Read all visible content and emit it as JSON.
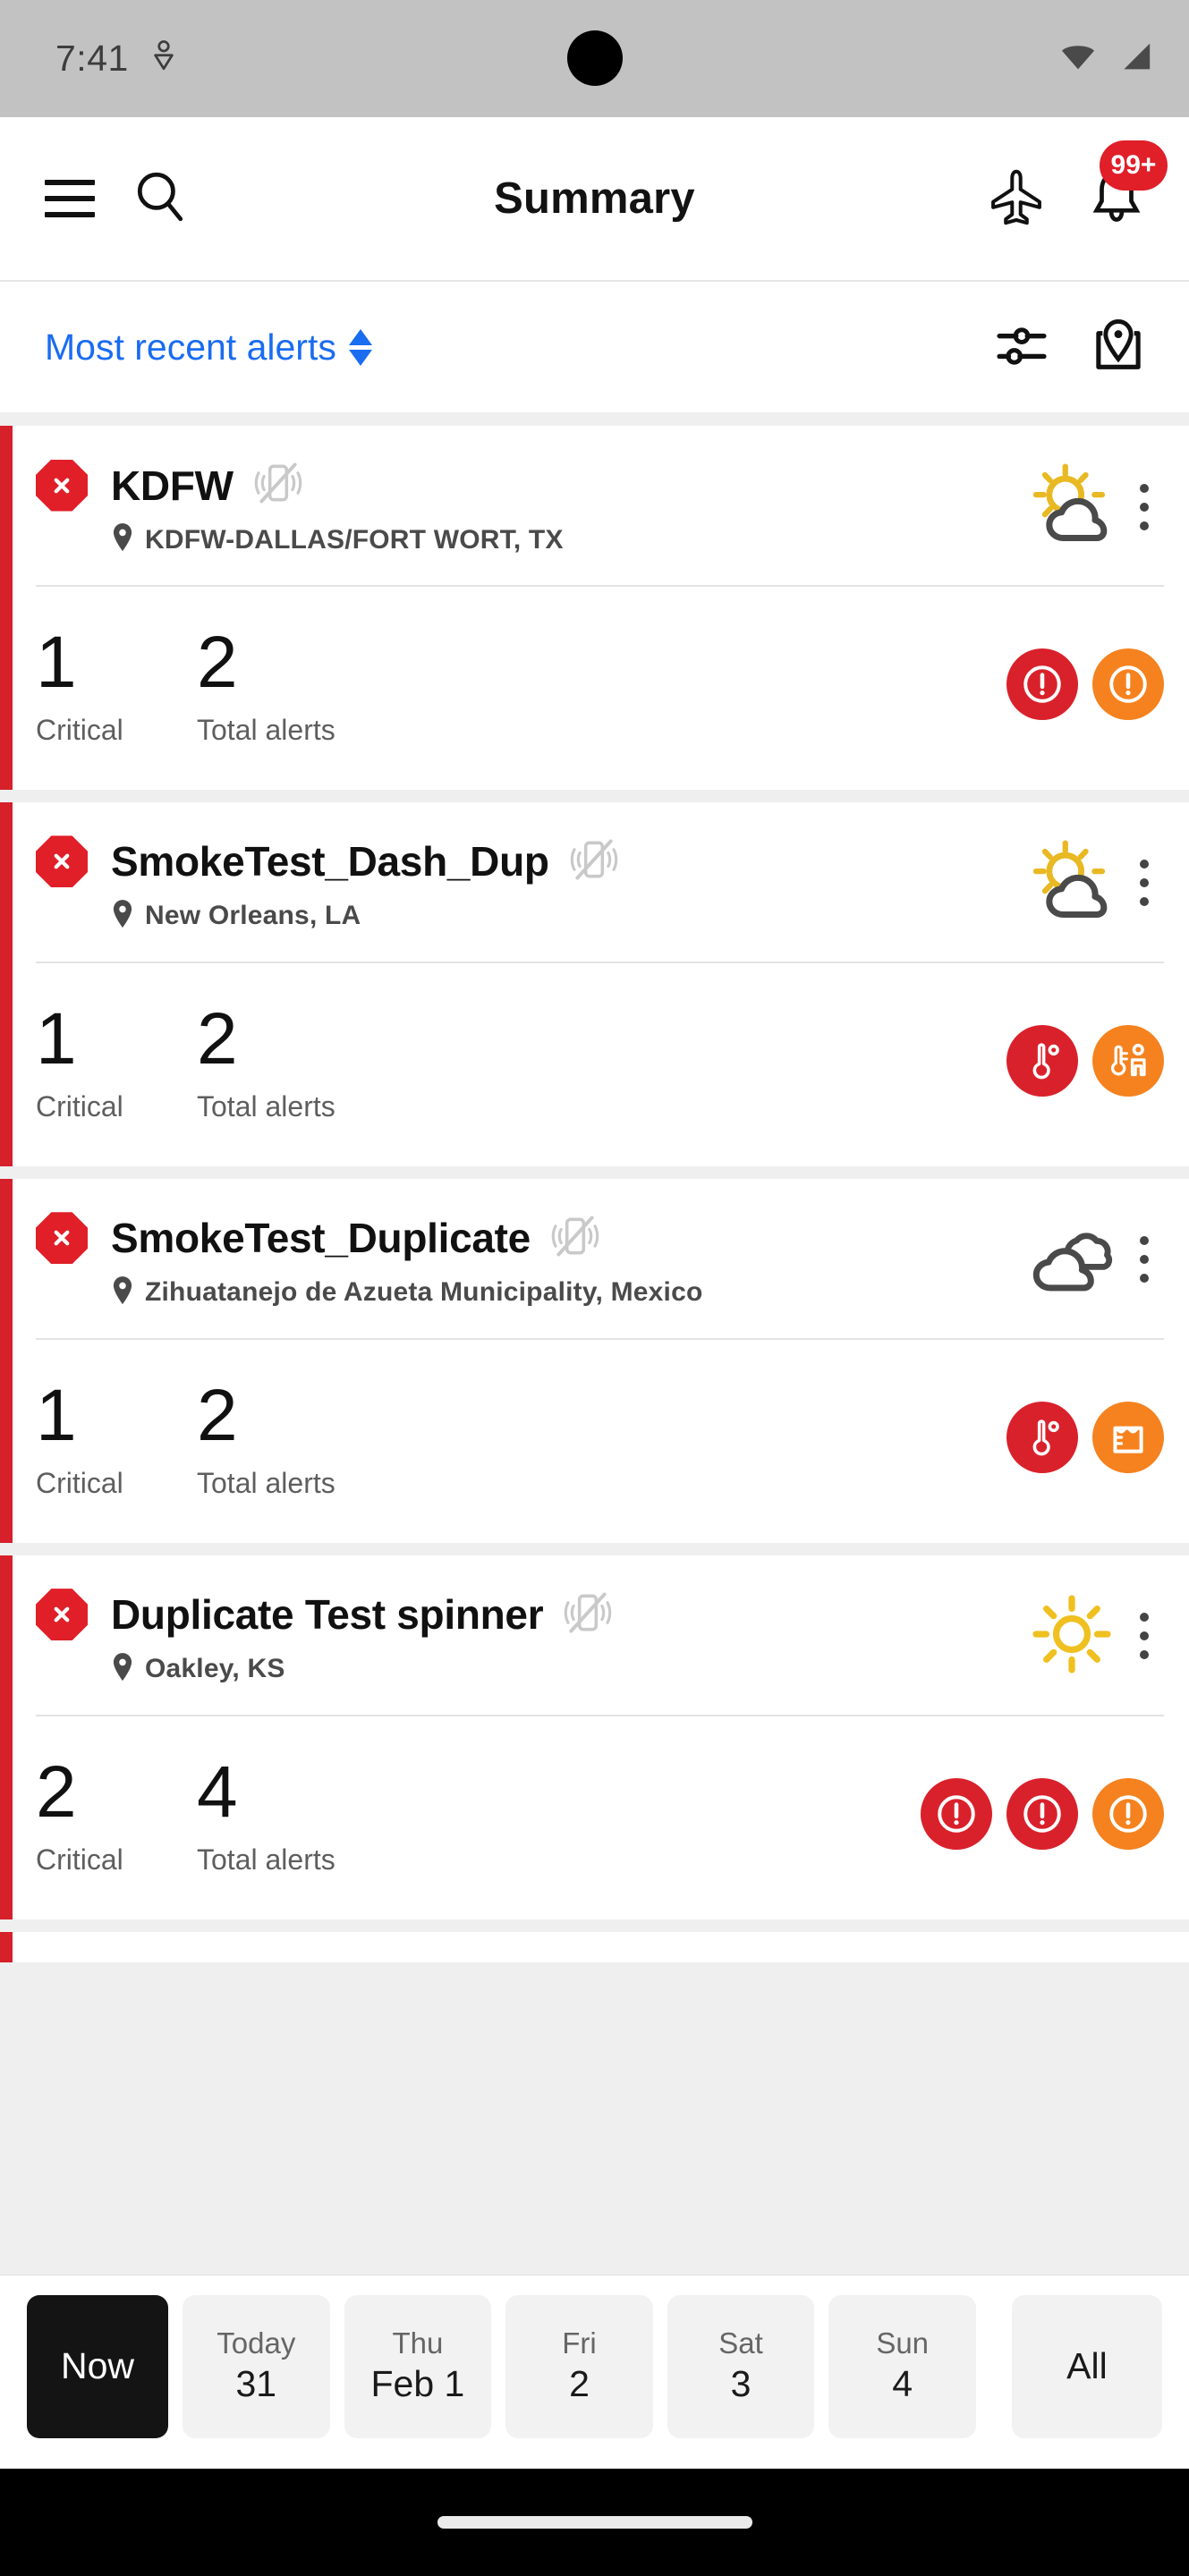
{
  "status_bar": {
    "time": "7:41",
    "left_icon": "location-sharing-icon",
    "wifi_icon": "wifi-icon",
    "signal_icon": "cellular-signal-icon"
  },
  "app_bar": {
    "menu_icon": "hamburger-menu-icon",
    "search_icon": "search-icon",
    "title": "Summary",
    "flight_icon": "airplane-icon",
    "notifications_icon": "bell-icon",
    "notification_badge": "99+",
    "badge_color": "#e01f28"
  },
  "filter_bar": {
    "sort_label": "Most recent alerts",
    "sort_icon": "sort-arrows-icon",
    "sort_color": "#1a6cf0",
    "filter_icon": "filter-sliders-icon",
    "map_icon": "map-pin-icon"
  },
  "cards": [
    {
      "status_icon": "stop-octagon-x-icon",
      "name": "KDFW",
      "mute_icon": "vibrate-off-icon",
      "location": "KDFW-DALLAS/FORT WORT, TX",
      "location_icon": "map-pin-icon",
      "weather_icon": "partly-cloudy-icon",
      "menu_icon": "kebab-menu-icon",
      "critical_value": "1",
      "critical_label": "Critical",
      "total_value": "2",
      "total_label": "Total alerts",
      "badges": [
        {
          "icon": "alert-exclamation-icon",
          "color": "red"
        },
        {
          "icon": "alert-exclamation-icon",
          "color": "orange"
        }
      ]
    },
    {
      "status_icon": "stop-octagon-x-icon",
      "name": "SmokeTest_Dash_Dup",
      "mute_icon": "vibrate-off-icon",
      "location": "New Orleans, LA",
      "location_icon": "map-pin-icon",
      "weather_icon": "partly-cloudy-icon",
      "menu_icon": "kebab-menu-icon",
      "critical_value": "1",
      "critical_label": "Critical",
      "total_value": "2",
      "total_label": "Total alerts",
      "badges": [
        {
          "icon": "temperature-icon",
          "color": "red"
        },
        {
          "icon": "feels-like-temperature-icon",
          "color": "orange"
        }
      ]
    },
    {
      "status_icon": "stop-octagon-x-icon",
      "name": "SmokeTest_Duplicate",
      "mute_icon": "vibrate-off-icon",
      "location": "Zihuatanejo de Azueta Municipality, Mexico",
      "location_icon": "map-pin-icon",
      "weather_icon": "cloudy-icon",
      "menu_icon": "kebab-menu-icon",
      "critical_value": "1",
      "critical_label": "Critical",
      "total_value": "2",
      "total_label": "Total alerts",
      "badges": [
        {
          "icon": "temperature-icon",
          "color": "red"
        },
        {
          "icon": "rain-gauge-icon",
          "color": "orange"
        }
      ]
    },
    {
      "status_icon": "stop-octagon-x-icon",
      "name": "Duplicate Test spinner",
      "mute_icon": "vibrate-off-icon",
      "location": "Oakley, KS",
      "location_icon": "map-pin-icon",
      "weather_icon": "sunny-icon",
      "menu_icon": "kebab-menu-icon",
      "critical_value": "2",
      "critical_label": "Critical",
      "total_value": "4",
      "total_label": "Total alerts",
      "badges": [
        {
          "icon": "alert-exclamation-icon",
          "color": "red"
        },
        {
          "icon": "alert-exclamation-icon",
          "color": "red"
        },
        {
          "icon": "alert-exclamation-icon",
          "color": "orange"
        }
      ]
    }
  ],
  "date_tabs": [
    {
      "sub": "",
      "main": "Now",
      "selected": true
    },
    {
      "sub": "Today",
      "main": "31",
      "selected": false
    },
    {
      "sub": "Thu",
      "main": "Feb 1",
      "selected": false
    },
    {
      "sub": "Fri",
      "main": "2",
      "selected": false
    },
    {
      "sub": "Sat",
      "main": "3",
      "selected": false
    },
    {
      "sub": "Sun",
      "main": "4",
      "selected": false
    },
    {
      "sub": "",
      "main": "All",
      "selected": false
    }
  ],
  "colors": {
    "accent_red": "#d6202a",
    "badge_red": "#d9212b",
    "badge_orange": "#f5821f",
    "link_blue": "#1a6cf0",
    "sun_yellow": "#e8b923"
  }
}
